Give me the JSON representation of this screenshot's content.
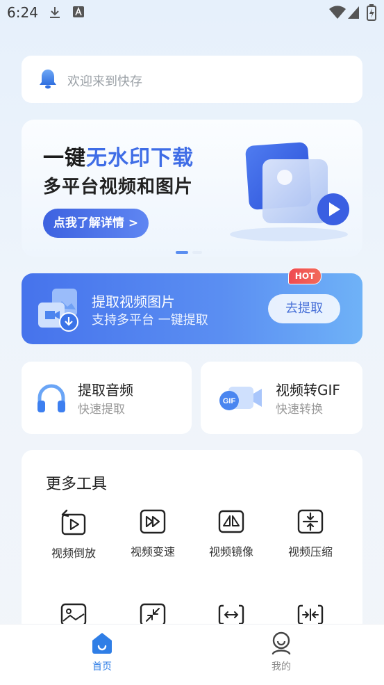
{
  "status_bar": {
    "time": "6:24"
  },
  "notice": {
    "text": "欢迎来到快存"
  },
  "banner": {
    "line1_prefix": "一键",
    "line1_highlight": "无水印下载",
    "line2": "多平台视频和图片",
    "button": "点我了解详情 >"
  },
  "extract_card": {
    "badge": "HOT",
    "title": "提取视频图片",
    "subtitle": "支持多平台 一键提取",
    "button": "去提取"
  },
  "feature_cards": [
    {
      "title": "提取音频",
      "subtitle": "快速提取"
    },
    {
      "title": "视频转GIF",
      "subtitle": "快速转换",
      "icon_text": "GIF"
    }
  ],
  "tools": {
    "heading": "更多工具",
    "items": [
      {
        "label": "视频倒放",
        "icon": "video-reverse-icon"
      },
      {
        "label": "视频变速",
        "icon": "video-speed-icon"
      },
      {
        "label": "视频镜像",
        "icon": "video-mirror-icon"
      },
      {
        "label": "视频压缩",
        "icon": "video-compress-icon"
      }
    ]
  },
  "tab_bar": {
    "tabs": [
      {
        "label": "首页",
        "icon": "home-icon",
        "active": true
      },
      {
        "label": "我的",
        "icon": "profile-icon",
        "active": false
      }
    ]
  },
  "colors": {
    "accent": "#3f6de6",
    "active_tab": "#2f7ee6",
    "inactive_tab": "#888888"
  }
}
